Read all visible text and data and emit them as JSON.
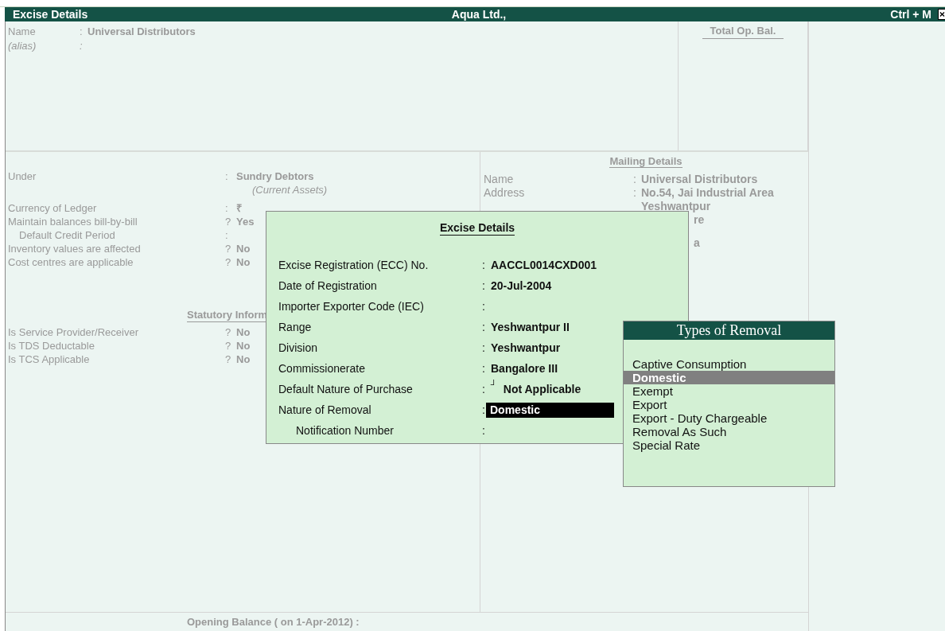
{
  "title_bar": {
    "title": "Excise Details",
    "company": "Aqua Ltd.,",
    "shortcut": "Ctrl + M"
  },
  "ledger": {
    "name_label": "Name",
    "name_colon": ":",
    "name": "Universal Distributors",
    "alias_label": "(alias)",
    "alias_colon": ":"
  },
  "total_op_bal": {
    "label": "Total Op. Bal."
  },
  "left_panel": {
    "under_label": "Under",
    "under_colon": ":",
    "under": "Sundry Debtors",
    "under_group": "(Current Assets)",
    "rows": [
      {
        "label": "Currency of Ledger",
        "sep": ":",
        "value": "₹",
        "sub": false
      },
      {
        "label": "Maintain balances bill-by-bill",
        "sep": "?",
        "value": "Yes",
        "sub": false
      },
      {
        "label": "Default Credit Period",
        "sep": ":",
        "sub": true
      },
      {
        "label": "Inventory values are affected",
        "sep": "?",
        "value": "No",
        "sub": false
      },
      {
        "label": "Cost centres are applicable",
        "sep": "?",
        "value": "No",
        "sub": false
      }
    ],
    "statutory_heading": "Statutory Inform",
    "statutory_rows": [
      {
        "label": "Is Service Provider/Receiver",
        "sep": "?",
        "value": "No"
      },
      {
        "label": "Is TDS Deductable",
        "sep": "?",
        "value": "No"
      },
      {
        "label": "Is TCS Applicable",
        "sep": "?",
        "value": "No"
      }
    ]
  },
  "mailing": {
    "heading": "Mailing Details",
    "name_label": "Name",
    "name_colon": ":",
    "name": "Universal Distributors",
    "address_label": "Address",
    "address_colon": ":",
    "address": [
      {
        "text": "No.54, Jai Industrial Area",
        "kind": "line"
      },
      {
        "text": "Yeshwantpur",
        "kind": "line"
      },
      {
        "text": "re",
        "kind": "cut"
      },
      {
        "kind": "hidden"
      },
      {
        "text": "a",
        "kind": "cut"
      }
    ]
  },
  "opening_balance": "Opening Balance ( on 1-Apr-2012) :",
  "dialog": {
    "title": "Excise Details",
    "fields": [
      {
        "label": "Excise Registration (ECC) No.",
        "colon": ":",
        "value": "AACCL0014CXD001",
        "sub": false,
        "active": false
      },
      {
        "label": "Date of Registration",
        "colon": ":",
        "value": "20-Jul-2004",
        "sub": false,
        "active": false
      },
      {
        "label": "Importer Exporter Code (IEC)",
        "colon": ":",
        "sub": false,
        "active": false
      },
      {
        "label": "Range",
        "colon": ":",
        "value": "Yeshwantpur II",
        "sub": false,
        "active": false
      },
      {
        "label": "Division",
        "colon": ":",
        "value": "Yeshwantpur",
        "sub": false,
        "active": false
      },
      {
        "label": "Commissionerate",
        "colon": ":",
        "value": "Bangalore III",
        "sub": false,
        "active": false
      },
      {
        "label": "Default Nature of Purchase",
        "colon": ":",
        "mark": "┘",
        "value": "Not Applicable",
        "sub": false,
        "active": false
      },
      {
        "label": "Nature of Removal",
        "colon": ":",
        "value": "Domestic",
        "sub": false,
        "active": true
      },
      {
        "label": "Notification Number",
        "colon": ":",
        "sub": true,
        "active": false
      }
    ]
  },
  "popup": {
    "title": "Types of Removal",
    "items": [
      {
        "label": "Captive Consumption",
        "selected": false
      },
      {
        "label": "Domestic",
        "selected": true
      },
      {
        "label": "Exempt",
        "selected": false
      },
      {
        "label": "Export",
        "selected": false
      },
      {
        "label": "Export - Duty Chargeable",
        "selected": false
      },
      {
        "label": "Removal As Such",
        "selected": false
      },
      {
        "label": "Special Rate",
        "selected": false
      }
    ]
  }
}
